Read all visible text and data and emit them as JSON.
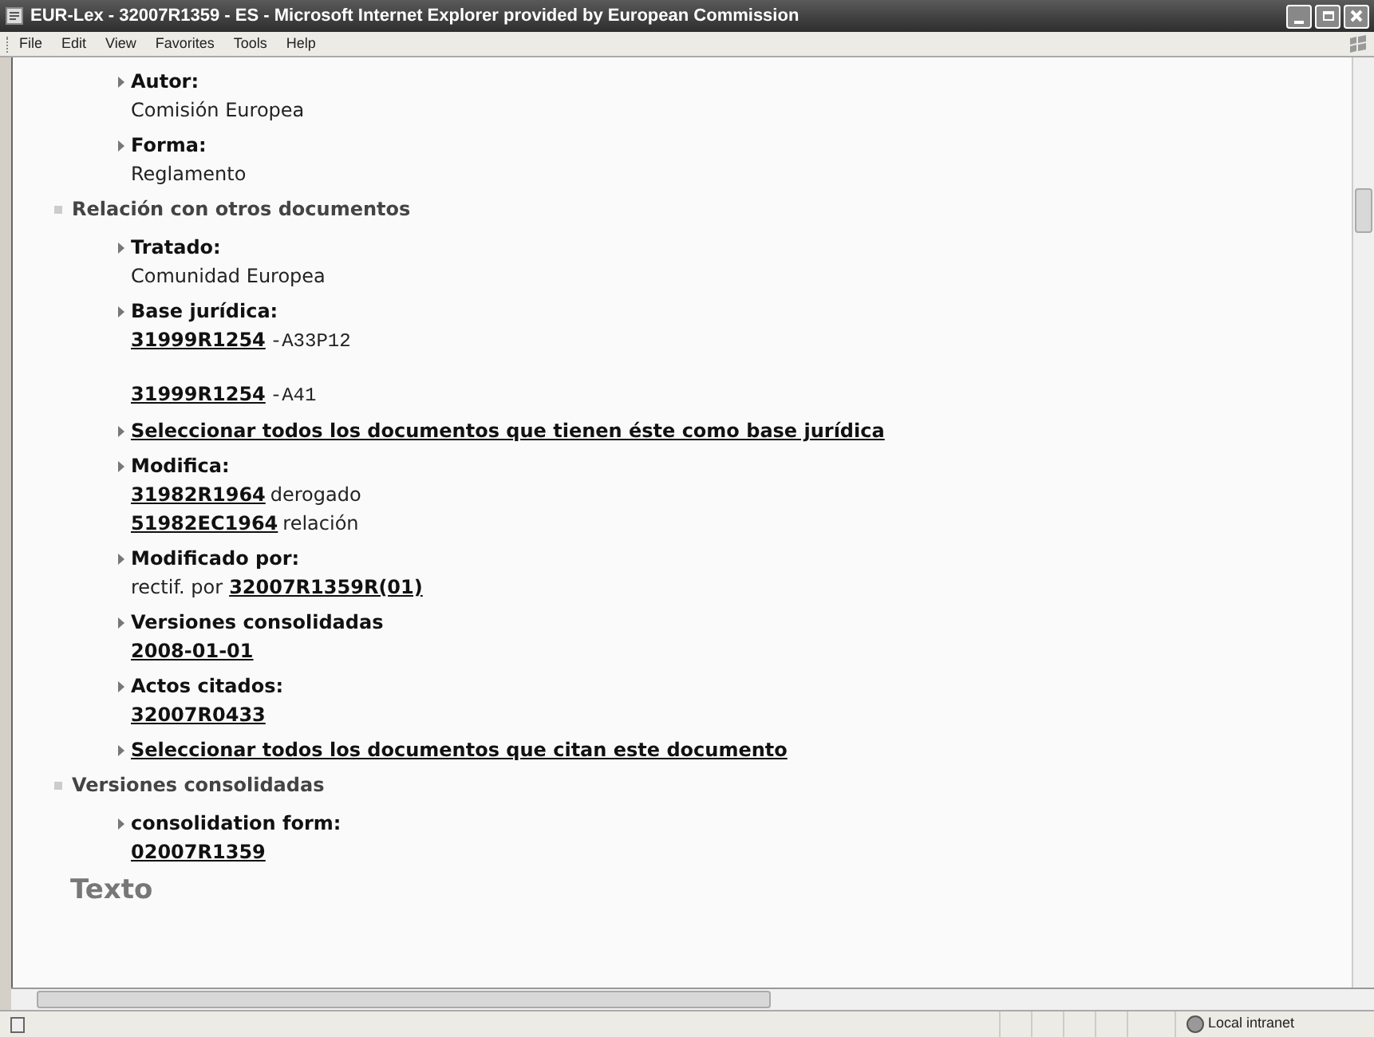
{
  "window": {
    "title": "EUR-Lex - 32007R1359 - ES - Microsoft Internet Explorer provided by European Commission"
  },
  "menu": [
    "File",
    "Edit",
    "View",
    "Favorites",
    "Tools",
    "Help"
  ],
  "sections": [
    {
      "items": [
        {
          "kind": "field",
          "label": "Autor:",
          "groups": [
            [
              [
                {
                  "kind": "plain",
                  "text": "Comisión Europea"
                }
              ]
            ]
          ]
        },
        {
          "kind": "field",
          "label": "Forma:",
          "groups": [
            [
              [
                {
                  "kind": "plain",
                  "text": "Reglamento"
                }
              ]
            ]
          ]
        }
      ]
    },
    {
      "heading": "Relación con otros documentos",
      "items": [
        {
          "kind": "field",
          "label": "Tratado:",
          "groups": [
            [
              [
                {
                  "kind": "plain",
                  "text": "Comunidad Europea"
                }
              ]
            ]
          ]
        },
        {
          "kind": "field",
          "label": "Base jurídica:",
          "groups": [
            [
              [
                {
                  "kind": "link",
                  "text": "31999R1254"
                },
                {
                  "kind": "mono",
                  "text": "-A33P12"
                }
              ]
            ],
            [
              [
                {
                  "kind": "link",
                  "text": "31999R1254"
                },
                {
                  "kind": "mono",
                  "text": "-A41"
                }
              ]
            ]
          ]
        },
        {
          "kind": "link",
          "label": "Seleccionar todos los documentos que tienen éste como base jurídica"
        },
        {
          "kind": "field",
          "label": "Modifica:",
          "groups": [
            [
              [
                {
                  "kind": "link",
                  "text": "31982R1964"
                },
                {
                  "kind": "plain",
                  "text": "derogado"
                }
              ],
              [
                {
                  "kind": "link",
                  "text": "51982EC1964"
                },
                {
                  "kind": "plain",
                  "text": "relación"
                }
              ]
            ]
          ]
        },
        {
          "kind": "field",
          "label": "Modificado por:",
          "groups": [
            [
              [
                {
                  "kind": "plain",
                  "text": "rectif. por"
                },
                {
                  "kind": "link",
                  "text": "32007R1359R(01)"
                }
              ]
            ]
          ]
        },
        {
          "kind": "field",
          "label": "Versiones consolidadas",
          "groups": [
            [
              [
                {
                  "kind": "link",
                  "text": "2008-01-01"
                }
              ]
            ]
          ]
        },
        {
          "kind": "field",
          "label": "Actos citados:",
          "groups": [
            [
              [
                {
                  "kind": "link",
                  "text": "32007R0433"
                }
              ]
            ]
          ]
        },
        {
          "kind": "link",
          "label": "Seleccionar todos los documentos que citan este documento"
        }
      ]
    },
    {
      "heading": "Versiones consolidadas",
      "items": [
        {
          "kind": "field",
          "label": "consolidation form:",
          "groups": [
            [
              [
                {
                  "kind": "link",
                  "text": "02007R1359"
                }
              ]
            ]
          ]
        }
      ]
    }
  ],
  "text_heading": "Texto",
  "status_bar": {
    "zone": "Local intranet"
  }
}
